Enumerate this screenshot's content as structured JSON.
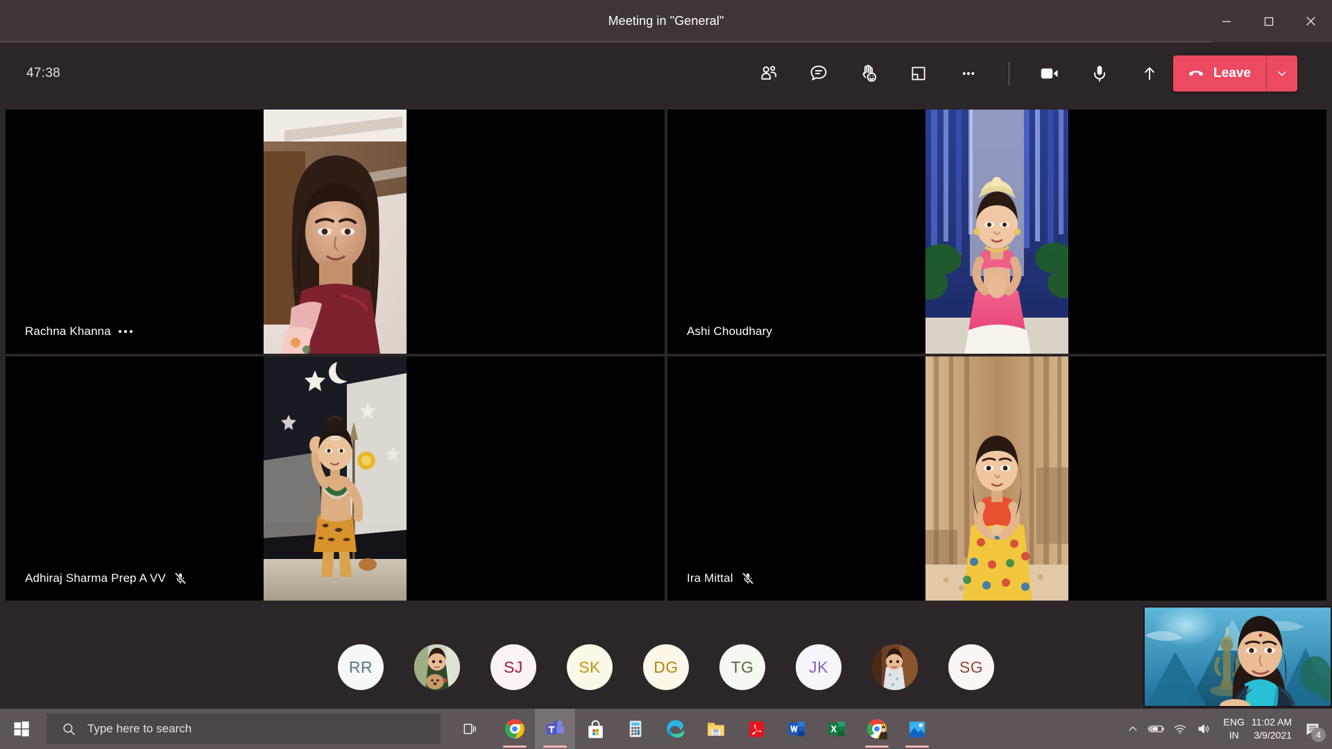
{
  "window": {
    "title": "Meeting in \"General\"",
    "controls": [
      {
        "name": "minimize",
        "glyph": "minimize-icon"
      },
      {
        "name": "maximize",
        "glyph": "maximize-icon"
      },
      {
        "name": "close",
        "glyph": "close-icon"
      }
    ]
  },
  "toolbar": {
    "timer": "47:38",
    "buttons": [
      {
        "id": "people",
        "icon": "people-icon",
        "label": "Show participants"
      },
      {
        "id": "chat",
        "icon": "chat-icon",
        "label": "Show conversation"
      },
      {
        "id": "reactions",
        "icon": "raise-hand-icon",
        "label": "Reactions"
      },
      {
        "id": "breakout",
        "icon": "breakout-rooms-icon",
        "label": "Breakout rooms"
      },
      {
        "id": "more",
        "icon": "more-options-icon",
        "label": "More actions"
      },
      {
        "id": "camera",
        "icon": "camera-icon",
        "label": "Turn camera off"
      },
      {
        "id": "mic",
        "icon": "microphone-icon",
        "label": "Mute"
      },
      {
        "id": "share",
        "icon": "share-screen-icon",
        "label": "Share content"
      }
    ],
    "leave_label": "Leave",
    "leave_icon": "hangup-phone-icon",
    "leave_caret_icon": "chevron-down-icon",
    "leave_color": "#eb4a62"
  },
  "grid": {
    "tiles": [
      {
        "name": "Rachna Khanna",
        "muted": false,
        "has_menu": true,
        "video": true,
        "scene": "scene-rachna"
      },
      {
        "name": "Ashi Choudhary",
        "muted": false,
        "has_menu": false,
        "video": true,
        "scene": "scene-ashi"
      },
      {
        "name": "Adhiraj Sharma Prep A VV",
        "muted": true,
        "has_menu": false,
        "video": true,
        "scene": "scene-adhiraj"
      },
      {
        "name": "Ira Mittal",
        "muted": true,
        "has_menu": false,
        "video": true,
        "scene": "scene-ira"
      }
    ],
    "mute_icon": "microphone-muted-icon"
  },
  "filmstrip": {
    "participants": [
      {
        "initials": "RR",
        "text_color": "#5a7384",
        "bg_color": "#f6f8fa",
        "photo": false
      },
      {
        "initials": "",
        "text_color": "",
        "bg_color": "#7e8a6a",
        "photo": true,
        "scene": "scene-av-child1"
      },
      {
        "initials": "SJ",
        "text_color": "#a4193d",
        "bg_color": "#fdf3f6",
        "photo": false
      },
      {
        "initials": "SK",
        "text_color": "#c69214",
        "bg_color": "#fdf9e8",
        "photo": false
      },
      {
        "initials": "DG",
        "text_color": "#c08006",
        "bg_color": "#fdf8ea",
        "photo": false
      },
      {
        "initials": "TG",
        "text_color": "#4f6b3f",
        "bg_color": "#f6f8f2",
        "photo": false
      },
      {
        "initials": "JK",
        "text_color": "#8065b5",
        "bg_color": "#f7f5fb",
        "photo": false
      },
      {
        "initials": "",
        "text_color": "",
        "bg_color": "#7a4a34",
        "photo": true,
        "scene": "scene-av-child2"
      },
      {
        "initials": "SG",
        "text_color": "#92443d",
        "bg_color": "#faf6f4",
        "photo": false
      }
    ],
    "selfview_label": "self-view-video"
  },
  "taskbar": {
    "start_icon": "windows-start-icon",
    "search": {
      "placeholder": "Type here to search",
      "icon": "search-icon"
    },
    "taskview_icon": "task-view-icon",
    "apps": [
      {
        "id": "chrome",
        "icon": "google-chrome-icon",
        "running": true,
        "active": false
      },
      {
        "id": "teams",
        "icon": "microsoft-teams-icon",
        "running": true,
        "active": true
      },
      {
        "id": "store",
        "icon": "microsoft-store-icon",
        "running": false,
        "active": false
      },
      {
        "id": "calculator",
        "icon": "calculator-icon",
        "running": false,
        "active": false
      },
      {
        "id": "edge",
        "icon": "microsoft-edge-icon",
        "running": false,
        "active": false
      },
      {
        "id": "explorer",
        "icon": "file-explorer-icon",
        "running": true,
        "active": false
      },
      {
        "id": "acrobat",
        "icon": "adobe-acrobat-icon",
        "running": true,
        "active": false
      },
      {
        "id": "word",
        "icon": "microsoft-word-icon",
        "running": true,
        "active": false
      },
      {
        "id": "excel",
        "icon": "microsoft-excel-icon",
        "running": true,
        "active": false
      },
      {
        "id": "chrome2",
        "icon": "google-chrome-icon",
        "running": true,
        "active": false
      },
      {
        "id": "photos",
        "icon": "photos-icon",
        "running": true,
        "active": false
      }
    ],
    "tray": {
      "chevron_icon": "show-hidden-icons-icon",
      "battery_icon": "battery-charging-icon",
      "wifi_icon": "wifi-icon",
      "volume_icon": "volume-icon",
      "lang_line1": "ENG",
      "lang_line2": "IN",
      "time": "11:02 AM",
      "date": "3/9/2021",
      "notification_icon": "action-center-icon",
      "notification_count": "4"
    }
  }
}
